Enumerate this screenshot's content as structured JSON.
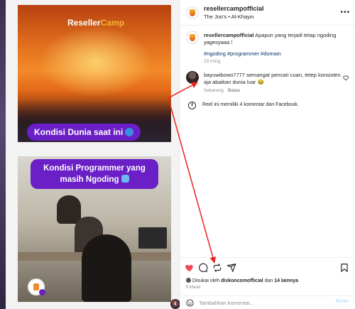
{
  "media": {
    "panel1": {
      "logo_text_a": "Reseller",
      "logo_text_b": "Camp",
      "caption": "Kondisi Dunia saat ini"
    },
    "panel2": {
      "caption": "Kondisi Programmer yang masih Ngoding"
    }
  },
  "post": {
    "author": "resellercampofficial",
    "audio": "The Joo's • Al-Khayin",
    "more_label": "•••"
  },
  "caption": {
    "username": "resellercampofficial",
    "text": "Apapun yang terjadi tetap ngoding yagesyaaa !",
    "hashtags": "#ngoding #programmer #domain",
    "time": "23 ming"
  },
  "comment": {
    "username": "bayuwibowo7777",
    "text": "semangat pencari cuan, tetep konsisten aja abaikan dunia luar 😂",
    "time": "Sekarang",
    "reply_label": "Balas"
  },
  "facebook_note": {
    "icon_letter": "f",
    "text": "Reel ini memiliki 4 komentar dari Facebook."
  },
  "likes": {
    "prefix": "Disukai oleh",
    "user": "diskoncomofficial",
    "connector": "dan",
    "others": "14 lainnya"
  },
  "date": "9 Maret",
  "add_comment": {
    "placeholder": "Tambahkan komentar...",
    "post_label": "Kirim"
  },
  "colors": {
    "like_red": "#ed4956",
    "annotation_red": "#e8241f",
    "caption_purple": "#6a1fc7",
    "link_blue": "#00376b"
  }
}
